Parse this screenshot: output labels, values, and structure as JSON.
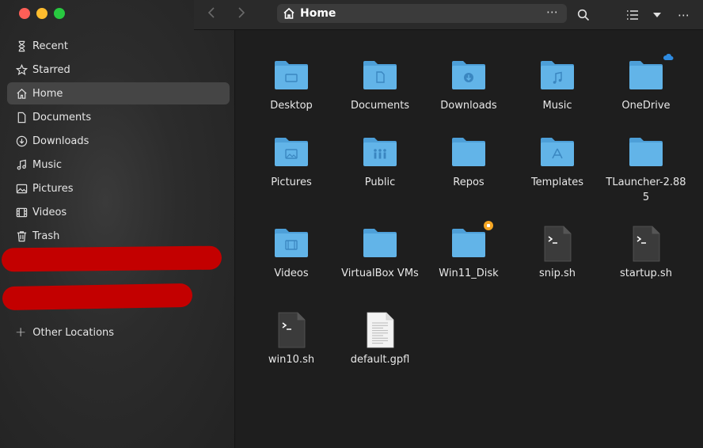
{
  "header": {
    "path_label": "Home",
    "back_icon": "chevron-left-icon",
    "forward_icon": "chevron-right-icon",
    "more_label": "⋯",
    "menu_label": "⋯"
  },
  "sidebar": {
    "items": [
      {
        "label": "Recent",
        "icon": "clock-icon"
      },
      {
        "label": "Starred",
        "icon": "star-icon"
      },
      {
        "label": "Home",
        "icon": "home-icon",
        "active": true
      },
      {
        "label": "Documents",
        "icon": "document-icon"
      },
      {
        "label": "Downloads",
        "icon": "download-icon"
      },
      {
        "label": "Music",
        "icon": "music-icon"
      },
      {
        "label": "Pictures",
        "icon": "picture-icon"
      },
      {
        "label": "Videos",
        "icon": "film-icon"
      },
      {
        "label": "Trash",
        "icon": "trash-icon"
      }
    ],
    "other_locations": "Other Locations"
  },
  "files": [
    {
      "name": "Desktop",
      "kind": "folder",
      "emblem": "desktop"
    },
    {
      "name": "Documents",
      "kind": "folder",
      "emblem": "document"
    },
    {
      "name": "Downloads",
      "kind": "folder",
      "emblem": "download"
    },
    {
      "name": "Music",
      "kind": "folder",
      "emblem": "music"
    },
    {
      "name": "OneDrive",
      "kind": "folder",
      "emblem": "",
      "badge": "cloud"
    },
    {
      "name": "Pictures",
      "kind": "folder",
      "emblem": "picture"
    },
    {
      "name": "Public",
      "kind": "folder",
      "emblem": "people"
    },
    {
      "name": "Repos",
      "kind": "folder",
      "emblem": ""
    },
    {
      "name": "Templates",
      "kind": "folder",
      "emblem": "template"
    },
    {
      "name": "TLauncher-2.885",
      "kind": "folder",
      "emblem": ""
    },
    {
      "name": "Videos",
      "kind": "folder",
      "emblem": "film"
    },
    {
      "name": "VirtualBox VMs",
      "kind": "folder",
      "emblem": ""
    },
    {
      "name": "Win11_Disk",
      "kind": "folder",
      "emblem": "",
      "badge": "lock"
    },
    {
      "name": "snip.sh",
      "kind": "script"
    },
    {
      "name": "startup.sh",
      "kind": "script"
    },
    {
      "name": "win10.sh",
      "kind": "script"
    },
    {
      "name": "default.gpfl",
      "kind": "text"
    }
  ],
  "colors": {
    "folder_body": "#62b4e8",
    "folder_tab": "#4d9fd8",
    "accent_red": "#c30000"
  }
}
